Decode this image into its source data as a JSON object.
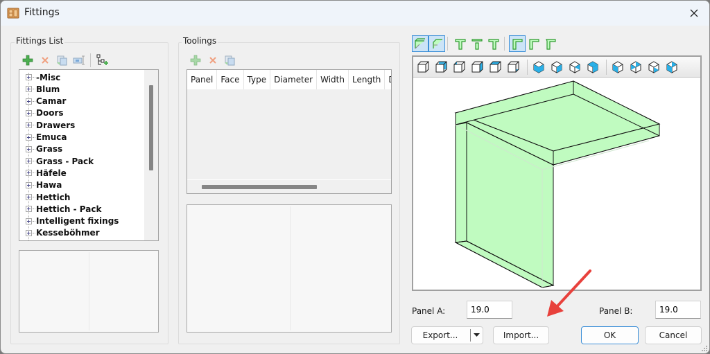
{
  "window": {
    "title": "Fittings",
    "app_icon": "cabinet-icon",
    "close_icon": "close-icon"
  },
  "fittings_list": {
    "label": "Fittings List",
    "toolbar": [
      {
        "name": "add-fitting-button",
        "icon": "green-plus-icon",
        "enabled": true
      },
      {
        "name": "delete-fitting-button",
        "icon": "red-x-icon",
        "enabled": false
      },
      {
        "name": "copy-fitting-button",
        "icon": "copy-icon",
        "enabled": false
      },
      {
        "name": "rename-fitting-button",
        "icon": "rename-icon",
        "enabled": false
      },
      {
        "name": "add-group-button",
        "icon": "tree-add-icon",
        "enabled": true
      }
    ],
    "items": [
      "-Misc",
      "Blum",
      "Camar",
      "Doors",
      "Drawers",
      "Emuca",
      "Grass",
      "Grass - Pack",
      "Häfele",
      "Hawa",
      "Hettich",
      "Hettich - Pack",
      "Intelligent fixings",
      "Kesseböhmer"
    ]
  },
  "toolings": {
    "label": "Toolings",
    "toolbar": [
      {
        "name": "add-tooling-button",
        "icon": "green-plus-icon",
        "enabled": false
      },
      {
        "name": "delete-tooling-button",
        "icon": "red-x-icon",
        "enabled": false
      },
      {
        "name": "copy-tooling-button",
        "icon": "copy-icon",
        "enabled": false
      }
    ],
    "columns": [
      "Panel",
      "Face",
      "Type",
      "Diameter",
      "Width",
      "Length",
      "Dep"
    ],
    "rows": []
  },
  "view": {
    "joint_buttons": [
      {
        "name": "joint-type-1",
        "active": true
      },
      {
        "name": "joint-type-2",
        "active": true
      },
      {
        "name": "joint-type-3",
        "active": false
      },
      {
        "name": "joint-type-4",
        "active": false
      },
      {
        "name": "joint-type-5",
        "active": false
      },
      {
        "name": "joint-type-6",
        "active": true
      },
      {
        "name": "joint-type-7",
        "active": false
      },
      {
        "name": "joint-type-8",
        "active": false
      }
    ],
    "view_buttons": [
      "front-view",
      "back-view",
      "left-view",
      "right-view",
      "top-view",
      "bottom-view",
      "iso-view-1",
      "iso-view-2",
      "iso-view-3",
      "iso-view-4",
      "iso-view-5",
      "iso-view-6",
      "iso-view-7",
      "iso-view-8"
    ],
    "panel_color": "#c0fbc0"
  },
  "panel_a": {
    "label": "Panel A:",
    "value": "19.0"
  },
  "panel_b": {
    "label": "Panel B:",
    "value": "19.0"
  },
  "buttons": {
    "export": "Export...",
    "import": "Import...",
    "ok": "OK",
    "cancel": "Cancel"
  },
  "annotation": {
    "type": "arrow",
    "color": "#e8413c",
    "points_to": "Import..."
  }
}
